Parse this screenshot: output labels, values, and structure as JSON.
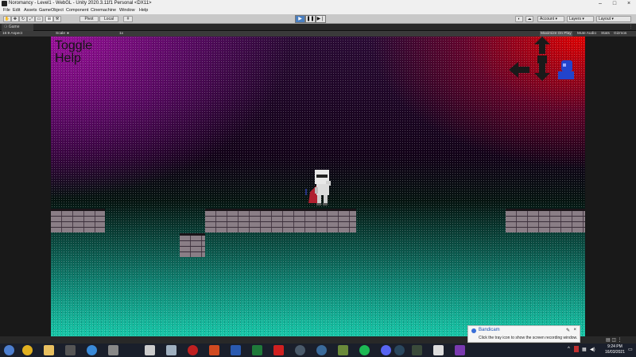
{
  "window": {
    "title": "Noromancy - Level1 - WebGL - Unity 2020.3.11f1 Personal <DX11>",
    "controls": [
      "–",
      "□",
      "×"
    ]
  },
  "menu": [
    "File",
    "Edit",
    "Assets",
    "GameObject",
    "Component",
    "Cinemachine",
    "Window",
    "Help"
  ],
  "toolbar": {
    "pivot": "Pivot",
    "local": "Local",
    "account": "Account",
    "layers": "Layers",
    "layout": "Layout",
    "play_icon": "play-icon",
    "pause_icon": "pause-icon",
    "step_icon": "step-icon"
  },
  "tab": {
    "label": "Game"
  },
  "game_bar": {
    "aspect": "16:9 Aspect",
    "scale_label": "Scale",
    "scale_value": "1x",
    "maximize": "Maximize On Play",
    "mute": "Mute Audio",
    "stats": "Stats",
    "gizmos": "Gizmos"
  },
  "game": {
    "toggle_help": "Toggle\nHelp",
    "colors": {
      "magenta": "#9a0f9a",
      "red": "#e00000",
      "teal": "#16c7a8"
    }
  },
  "notification": {
    "app": "Bandicam",
    "message": "Click the tray icon to show the screen recording window."
  },
  "taskbar": {
    "time": "9:24 PM",
    "date": "16/03/2021"
  }
}
